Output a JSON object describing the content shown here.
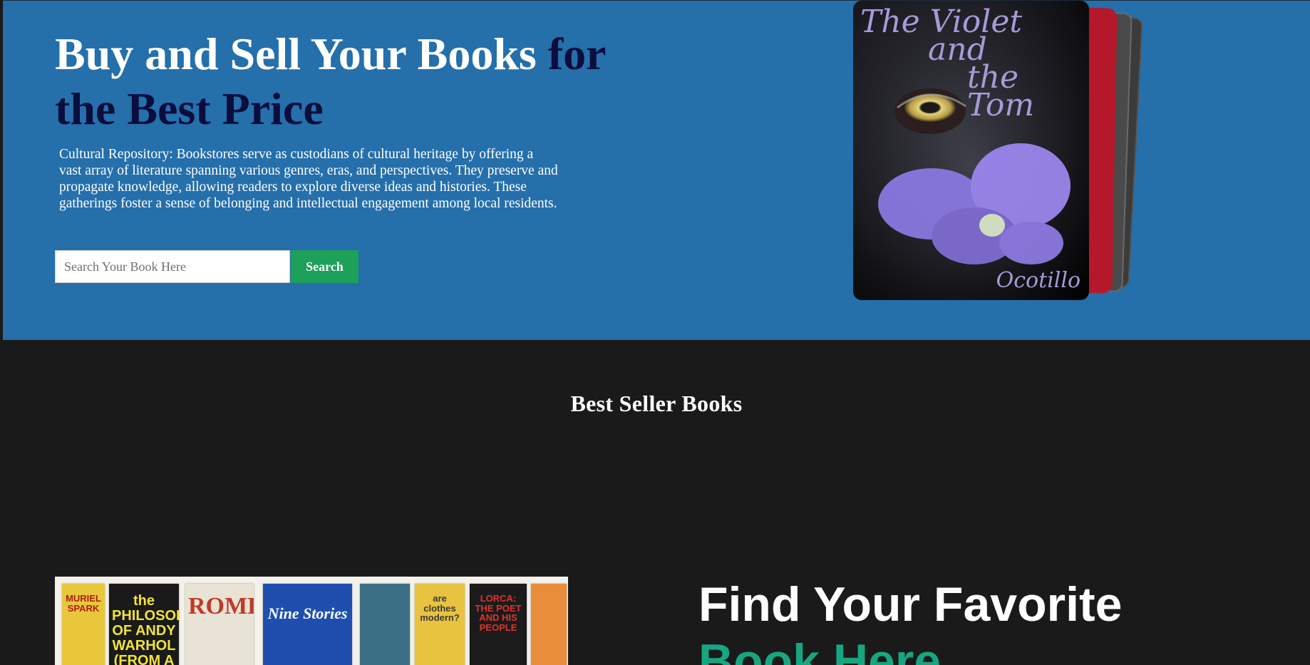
{
  "hero": {
    "title_main": "Buy and Sell Your Books ",
    "title_accent": "for the Best Price",
    "description": "Cultural Repository: Bookstores serve as custodians of cultural heritage by offering a vast array of literature spanning various genres, eras, and perspectives. They preserve and propagate knowledge, allowing readers to explore diverse ideas and histories. These gatherings foster a sense of belonging and intellectual engagement among local residents.",
    "search": {
      "placeholder": "Search Your Book Here",
      "value": "",
      "button_label": "Search"
    },
    "featured_book": {
      "title_line1": "The Violet",
      "title_line2": "and",
      "title_line3": "the Tom",
      "author": "Ocotillo"
    }
  },
  "best_sellers": {
    "heading": "Best Seller Books"
  },
  "feature": {
    "title_main": "Find Your Favorite",
    "title_accent": "Book Here",
    "photo_spines": [
      {
        "text": "MURIEL SPARK",
        "bg": "#e8c83a",
        "fg": "#b01c1c"
      },
      {
        "text": "the PHILOSOPHY OF ANDY WARHOL (FROM A TO B",
        "bg": "#1a1a1a",
        "fg": "#f2e23a"
      },
      {
        "text": "ROME",
        "bg": "#e9e3d5",
        "fg": "#c0392b"
      },
      {
        "text": "Nine Stories",
        "bg": "#1f4fae",
        "fg": "#ffffff"
      },
      {
        "text": "",
        "bg": "#3b6f86",
        "fg": "#ffffff"
      },
      {
        "text": "are clothes modern?",
        "bg": "#e8c340",
        "fg": "#3a3a3a"
      },
      {
        "text": "LORCA: THE POET AND HIS PEOPLE",
        "bg": "#1b1b1b",
        "fg": "#e0342b"
      },
      {
        "text": "",
        "bg": "#e98d3a",
        "fg": "#ffffff"
      }
    ]
  },
  "colors": {
    "hero_bg": "#256fab",
    "title_accent": "#0b0d3d",
    "search_button": "#1ca05a",
    "page_bg": "#1a1a1a",
    "find_accent": "#17a680"
  }
}
